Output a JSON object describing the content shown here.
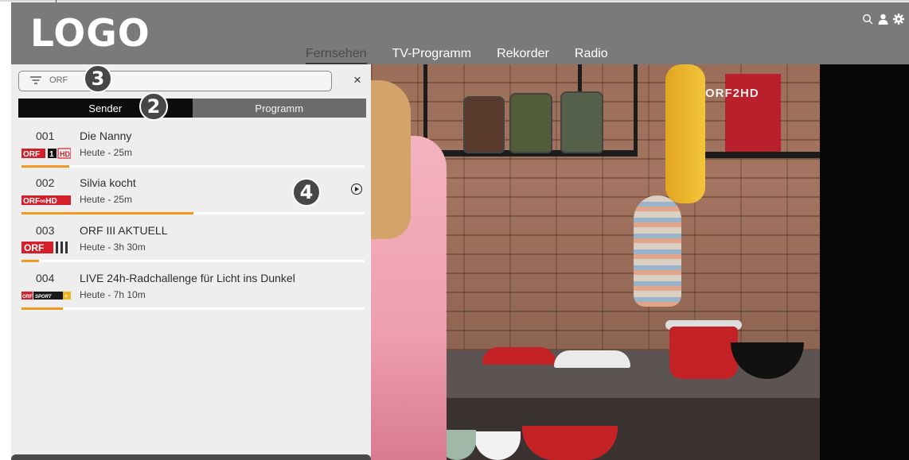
{
  "header": {
    "logo": "LOGO",
    "nav": [
      "Fernsehen",
      "TV-Programm",
      "Rekorder",
      "Radio"
    ],
    "active_nav": "Fernsehen",
    "icons": [
      "search-icon",
      "user-icon",
      "gear-icon"
    ]
  },
  "search": {
    "value": "ORF",
    "close": "×"
  },
  "tabs": {
    "sender": "Sender",
    "programm": "Programm"
  },
  "badges": {
    "b2": "2",
    "b3": "3",
    "b4": "4"
  },
  "channels": [
    {
      "num": "001",
      "title": "Die Nanny",
      "time": "Heute - 25m",
      "logo": "ORF1 HD",
      "progress": 0.14
    },
    {
      "num": "002",
      "title": "Silvia kocht",
      "time": "Heute - 25m",
      "logo": "ORF∞HD",
      "progress": 0.5
    },
    {
      "num": "003",
      "title": "ORF III AKTUELL",
      "time": "Heute - 3h 30m",
      "logo": "ORF III",
      "progress": 0.05
    },
    {
      "num": "004",
      "title": "LIVE 24h-Radchallenge für Licht ins Dunkel",
      "time": "Heute - 7h 10m",
      "logo": "ORF SPORT+",
      "progress": 0.12
    }
  ],
  "video": {
    "channel_logo": "ORF2HD"
  },
  "colors": {
    "accent": "#f29a1f",
    "header": "#7a7a7a",
    "tab_active": "#0c0c0c",
    "tab_inactive": "#6b6b6b"
  }
}
